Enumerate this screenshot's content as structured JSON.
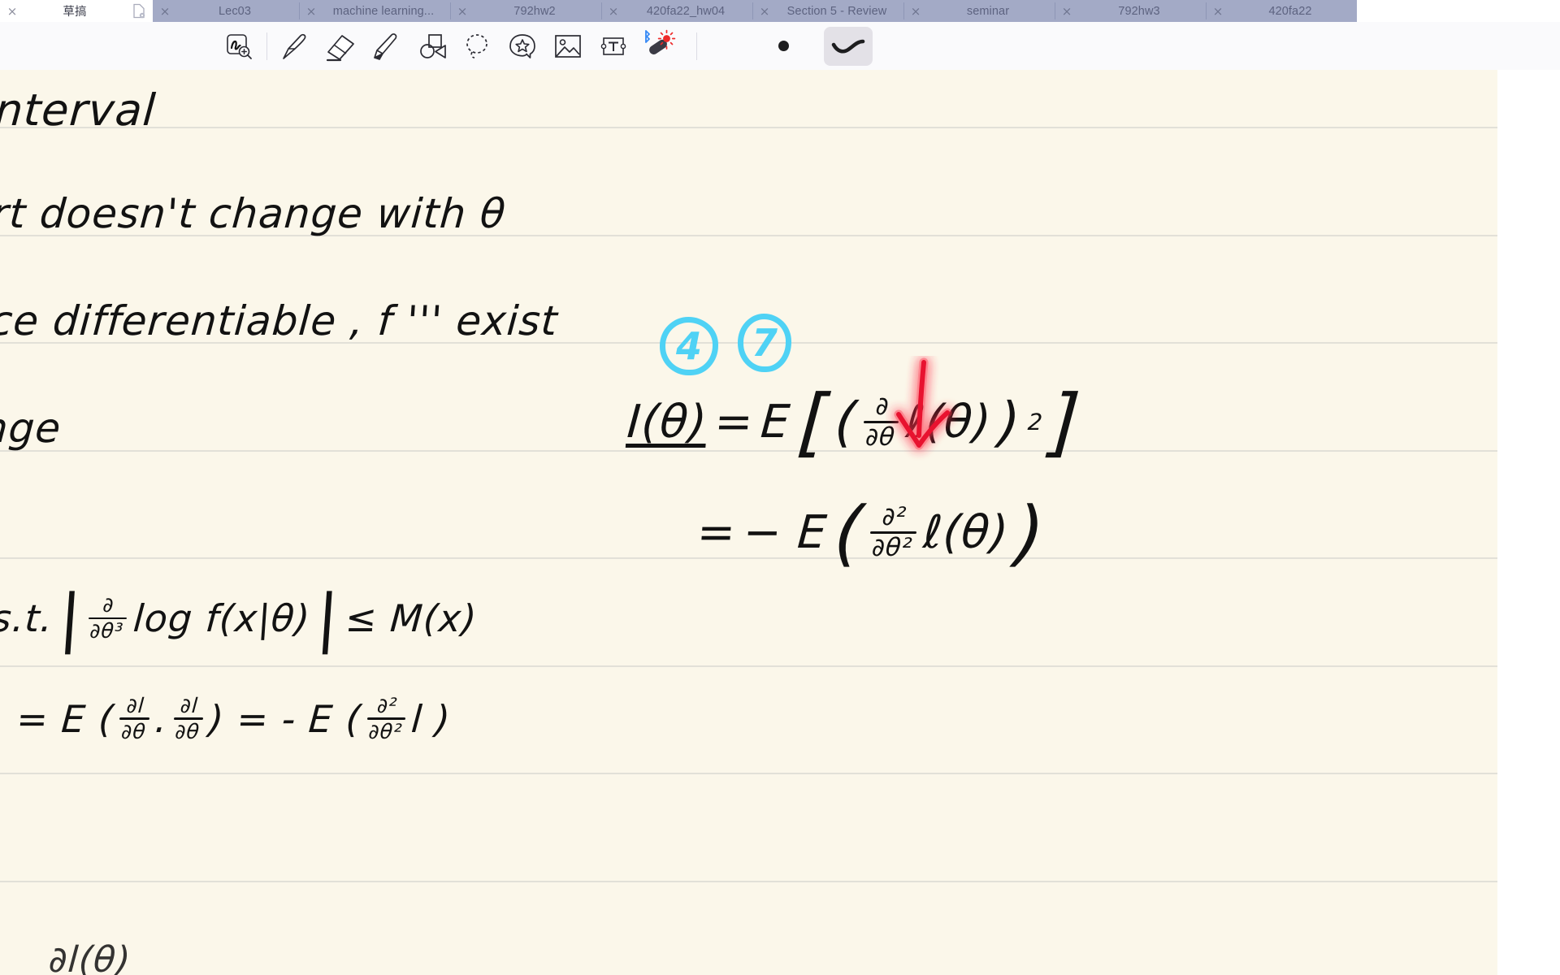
{
  "tabs": [
    {
      "label": "草搞",
      "active": true,
      "close": "×",
      "doc_icon": true
    },
    {
      "label": "Lec03",
      "active": false,
      "close": "×"
    },
    {
      "label": "machine learning...",
      "active": false,
      "close": "×"
    },
    {
      "label": "792hw2",
      "active": false,
      "close": "×"
    },
    {
      "label": "420fa22_hw04",
      "active": false,
      "close": "×"
    },
    {
      "label": "Section 5 - Review",
      "active": false,
      "close": "×"
    },
    {
      "label": "seminar",
      "active": false,
      "close": "×"
    },
    {
      "label": "792hw3",
      "active": false,
      "close": "×"
    },
    {
      "label": "420fa22",
      "active": false,
      "close": "×"
    }
  ],
  "toolbar": {
    "tools": [
      {
        "name": "zoom-write-icon",
        "label": "Zoom Write"
      },
      {
        "name": "pen-icon",
        "label": "Pen"
      },
      {
        "name": "eraser-icon",
        "label": "Eraser"
      },
      {
        "name": "highlighter-icon",
        "label": "Highlighter"
      },
      {
        "name": "shapes-icon",
        "label": "Shapes"
      },
      {
        "name": "lasso-select-icon",
        "label": "Lasso Select"
      },
      {
        "name": "sticker-icon",
        "label": "Sticker"
      },
      {
        "name": "image-icon",
        "label": "Image"
      },
      {
        "name": "text-tool-icon",
        "label": "Text"
      },
      {
        "name": "laser-pointer-icon",
        "label": "Laser Pointer"
      },
      {
        "name": "stroke-thickness-indicator",
        "label": "Thickness"
      },
      {
        "name": "stroke-style-button",
        "label": "Stroke Style",
        "selected": true
      }
    ]
  },
  "colors": {
    "tab_inactive_bg": "#a3aac6",
    "tab_active_bg": "#ffffff",
    "toolbar_bg": "#fafafc",
    "page_bg": "#fbf7ea",
    "rule_line": "#e2e0d8",
    "ink_black": "#121212",
    "annotation_cyan": "#4fd2f5",
    "annotation_red": "#e8122f",
    "laser_blue": "#3b8cf5",
    "selected_button_bg": "#e3e1e7"
  },
  "page": {
    "handwriting": {
      "line1": "nterval",
      "line2": "rt  doesn't  change  with  θ",
      "line3": "ce   differentiable   ,   f ''' exist",
      "line4": "nge",
      "st": {
        "label": "s.t.",
        "frac_num": "∂",
        "frac_den": "∂θ³",
        "expr": "log f(x|θ)",
        "bound": "≤ M(x)"
      },
      "bottom": {
        "prefix": ") = E (",
        "f1_num": "∂l",
        "f1_den": "∂θ",
        "mid": ".",
        "f2_num": "∂l",
        "f2_den": "∂θ",
        "eq": ") = - E (",
        "f3_num": "∂²",
        "f3_den": "∂θ²",
        "suffix": "l )"
      },
      "cutoff": "∂l(θ)"
    },
    "annotations": {
      "circled": [
        "4",
        "7"
      ],
      "red_arrow": "arrow pointing down at second derivative term"
    },
    "equations": {
      "eq1": {
        "lhs": "I(θ)",
        "eq": "=",
        "expect": "E",
        "frac_num": "∂",
        "frac_den": "∂θ",
        "loglik": "ℓ(θ)",
        "power": "2"
      },
      "eq2": {
        "eq": "=",
        "expect": "− E",
        "frac_num": "∂²",
        "frac_den": "∂θ²",
        "loglik": "ℓ(θ)"
      }
    }
  }
}
